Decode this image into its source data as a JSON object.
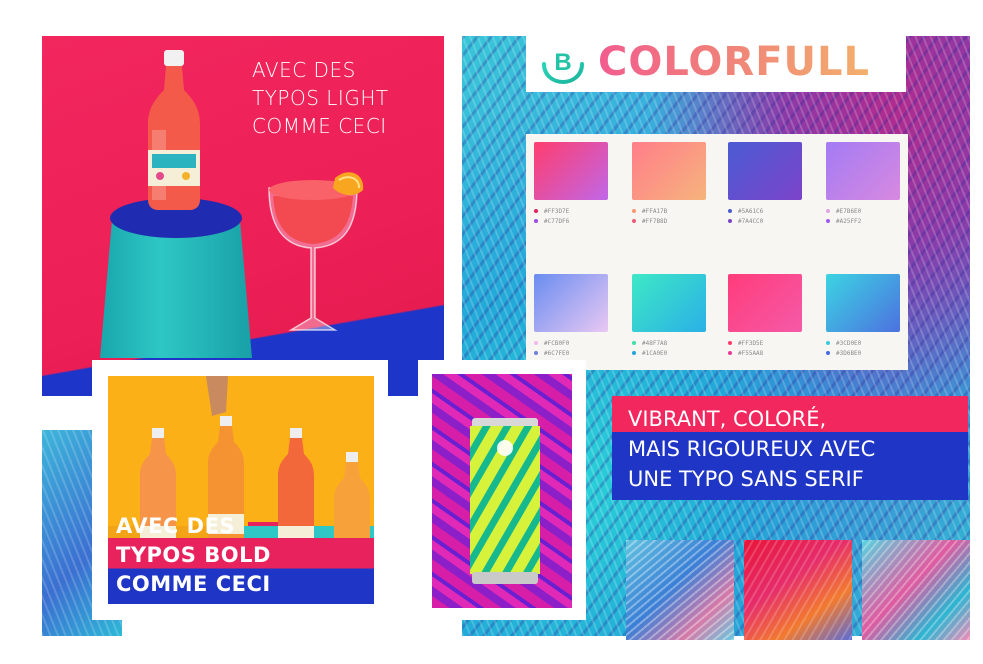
{
  "headline_light": [
    "AVEC DES",
    "TYPOS LIGHT",
    "COMME CECI"
  ],
  "headline_bold": [
    "AVEC DES",
    "TYPOS BOLD",
    "COMME CECI"
  ],
  "brand": {
    "logo_letter": "B",
    "name": "COLORFULL"
  },
  "vibrant_text": [
    "VIBRANT, COLORÉ,",
    "MAIS RIGOUREUX AVEC",
    "UNE TYPO SANS SERIF"
  ],
  "palette": [
    {
      "from": "#ff3d6e",
      "to": "#c067e8",
      "hex": [
        "#FF3D7E",
        "#C77DF6"
      ],
      "dots": [
        "#e3245e",
        "#9a4be0"
      ]
    },
    {
      "from": "#ff7d8a",
      "to": "#f6b47c",
      "hex": [
        "#FFA17B",
        "#FF7B8D"
      ],
      "dots": [
        "#f7986e",
        "#f05a78"
      ]
    },
    {
      "from": "#4a5bd3",
      "to": "#7c43c9",
      "hex": [
        "#5A61C6",
        "#7A4CC0"
      ],
      "dots": [
        "#4d5cd0",
        "#7a46c6"
      ]
    },
    {
      "from": "#a37bf4",
      "to": "#d889e0",
      "hex": [
        "#E7B6E0",
        "#A25FF2"
      ],
      "dots": [
        "#e0a5e0",
        "#9f5bef"
      ]
    },
    {
      "from": "#6a8df0",
      "to": "#e9c8f3",
      "hex": [
        "#FCB0F0",
        "#6C7FE0"
      ],
      "dots": [
        "#f4b7ee",
        "#6c80e0"
      ]
    },
    {
      "from": "#3ee8c6",
      "to": "#2ab0e6",
      "hex": [
        "#48F7A8",
        "#1CA0E0"
      ],
      "dots": [
        "#3de0a8",
        "#21a5e0"
      ]
    },
    {
      "from": "#ff3c7a",
      "to": "#f55aa8",
      "hex": [
        "#FF3D5E",
        "#F55AA8"
      ],
      "dots": [
        "#ff3c6a",
        "#ea3a98"
      ]
    },
    {
      "from": "#3bd4e2",
      "to": "#4d71e0",
      "hex": [
        "#3CD0E0",
        "#3D6BE0"
      ],
      "dots": [
        "#3bc9e0",
        "#466de0"
      ]
    }
  ],
  "colors": {
    "pink": "#f2275e",
    "blue": "#1f35c5",
    "teal": "#2ec7c5",
    "yellow": "#fbb018"
  }
}
